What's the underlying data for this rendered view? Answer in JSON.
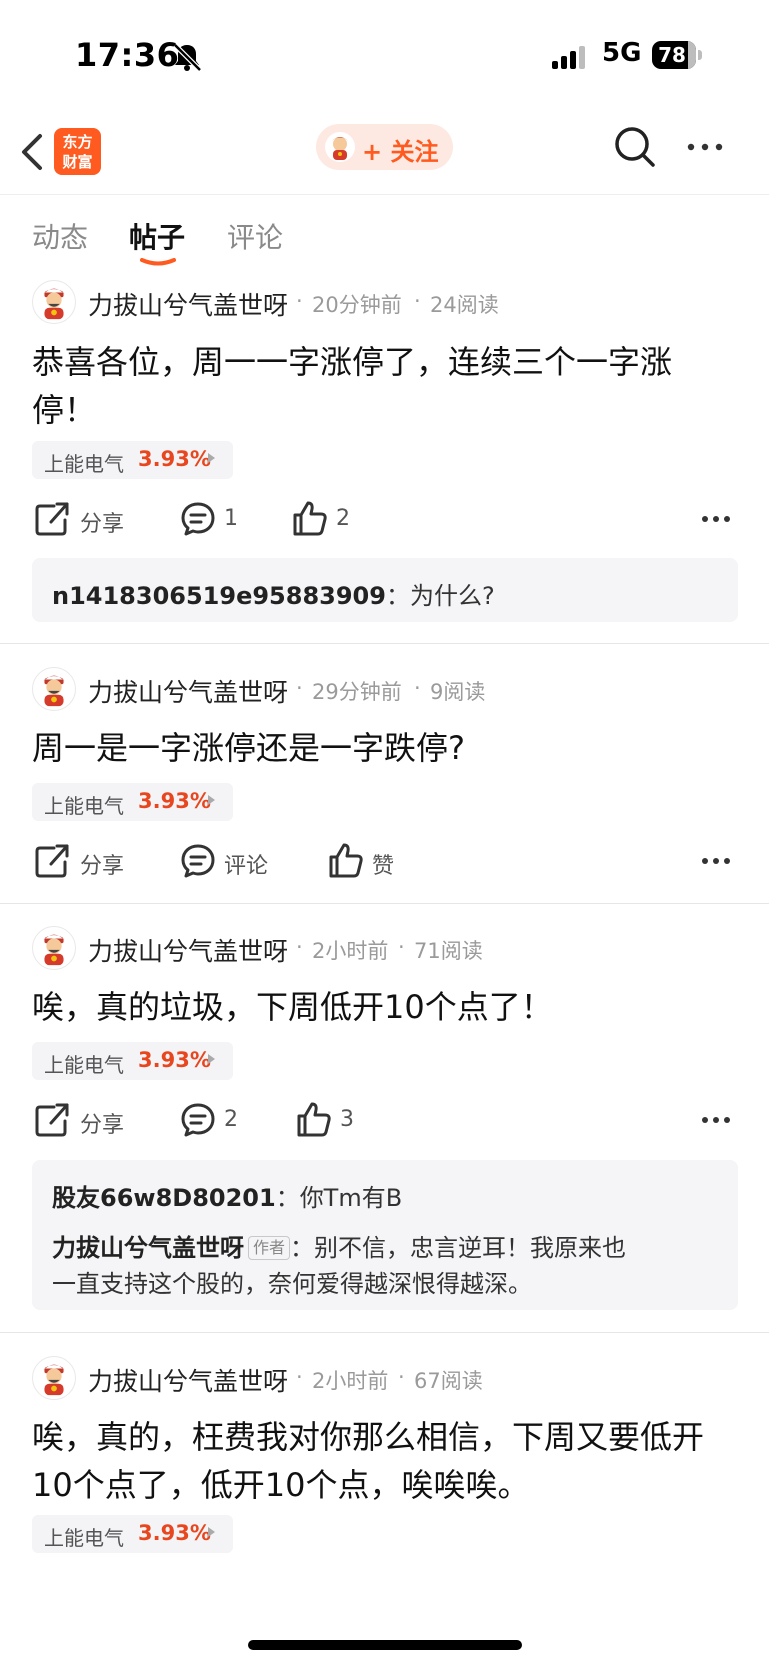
{
  "status_bar": {
    "time": "17:36",
    "network": "5G",
    "battery": "78"
  },
  "nav": {
    "logo_text_line1": "东方",
    "logo_text_line2": "财富",
    "follow_label": "+ 关注"
  },
  "tabs": [
    {
      "label": "动态",
      "active": false
    },
    {
      "label": "帖子",
      "active": true
    },
    {
      "label": "评论",
      "active": false
    }
  ],
  "posts": [
    {
      "author": "力拔山兮气盖世呀",
      "time": "20分钟前",
      "reads": "24阅读",
      "text": "恭喜各位，周一一字涨停了，连续三个一字涨停！",
      "stock": {
        "name": "上能电气",
        "change": "3.93%"
      },
      "actions": {
        "share": "分享",
        "comment": "1",
        "like": "2"
      },
      "comments": [
        {
          "user": "n1418306519e95883909",
          "sep": "：",
          "text": "为什么?"
        }
      ]
    },
    {
      "author": "力拔山兮气盖世呀",
      "time": "29分钟前",
      "reads": "9阅读",
      "text": "周一是一字涨停还是一字跌停?",
      "stock": {
        "name": "上能电气",
        "change": "3.93%"
      },
      "actions": {
        "share": "分享",
        "comment": "评论",
        "like": "赞"
      },
      "comments": []
    },
    {
      "author": "力拔山兮气盖世呀",
      "time": "2小时前",
      "reads": "71阅读",
      "text": "唉，真的垃圾，下周低开10个点了！",
      "stock": {
        "name": "上能电气",
        "change": "3.93%"
      },
      "actions": {
        "share": "分享",
        "comment": "2",
        "like": "3"
      },
      "comments": [
        {
          "user": "股友66w8D80201",
          "sep": "：",
          "text": "你Tm有B"
        },
        {
          "user": "力拔山兮气盖世呀",
          "badge": "作者",
          "sep": "：",
          "text_line1": "别不信，忠言逆耳！我原来也",
          "text_line2": "一直支持这个股的，奈何爱得越深恨得越深。"
        }
      ]
    },
    {
      "author": "力拔山兮气盖世呀",
      "time": "2小时前",
      "reads": "67阅读",
      "text_line1": "唉，真的，枉费我对你那么相信，下周又要低开",
      "text_line2": "10个点了，低开10个点，唉唉唉。",
      "stock": {
        "name": "上能电气",
        "change": "3.93%"
      }
    }
  ],
  "meta_sep": "·",
  "colors": {
    "accent": "#ff5a1f",
    "stock_up": "#e8461e",
    "comment_bg": "#f5f5f7"
  },
  "icons": [
    "back-arrow-icon",
    "search-icon",
    "more-icon",
    "share-icon",
    "comment-icon",
    "like-icon",
    "bell-muted-icon",
    "signal-icon",
    "battery-icon"
  ]
}
